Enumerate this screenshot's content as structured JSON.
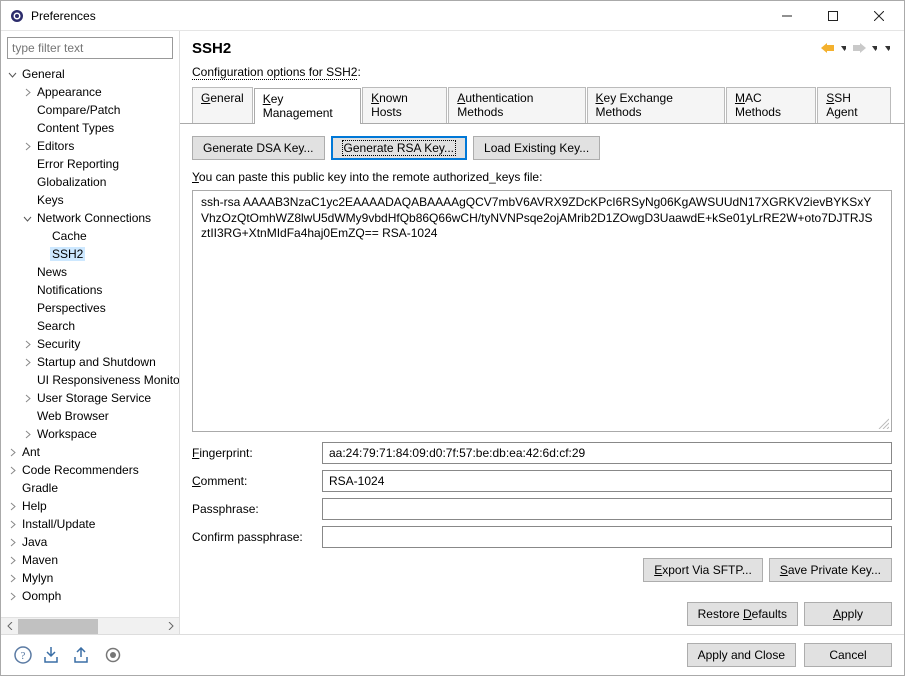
{
  "window": {
    "title": "Preferences"
  },
  "filter": {
    "placeholder": "type filter text"
  },
  "tree": {
    "items": [
      {
        "label": "General",
        "depth": 0,
        "expand": "open"
      },
      {
        "label": "Appearance",
        "depth": 1,
        "expand": "closed"
      },
      {
        "label": "Compare/Patch",
        "depth": 1,
        "expand": "none"
      },
      {
        "label": "Content Types",
        "depth": 1,
        "expand": "none"
      },
      {
        "label": "Editors",
        "depth": 1,
        "expand": "closed"
      },
      {
        "label": "Error Reporting",
        "depth": 1,
        "expand": "none"
      },
      {
        "label": "Globalization",
        "depth": 1,
        "expand": "none"
      },
      {
        "label": "Keys",
        "depth": 1,
        "expand": "none"
      },
      {
        "label": "Network Connections",
        "depth": 1,
        "expand": "open"
      },
      {
        "label": "Cache",
        "depth": 2,
        "expand": "none"
      },
      {
        "label": "SSH2",
        "depth": 2,
        "expand": "none",
        "selected": true
      },
      {
        "label": "News",
        "depth": 1,
        "expand": "none"
      },
      {
        "label": "Notifications",
        "depth": 1,
        "expand": "none"
      },
      {
        "label": "Perspectives",
        "depth": 1,
        "expand": "none"
      },
      {
        "label": "Search",
        "depth": 1,
        "expand": "none"
      },
      {
        "label": "Security",
        "depth": 1,
        "expand": "closed"
      },
      {
        "label": "Startup and Shutdown",
        "depth": 1,
        "expand": "closed"
      },
      {
        "label": "UI Responsiveness Monitoring",
        "depth": 1,
        "expand": "none"
      },
      {
        "label": "User Storage Service",
        "depth": 1,
        "expand": "closed"
      },
      {
        "label": "Web Browser",
        "depth": 1,
        "expand": "none"
      },
      {
        "label": "Workspace",
        "depth": 1,
        "expand": "closed"
      },
      {
        "label": "Ant",
        "depth": 0,
        "expand": "closed"
      },
      {
        "label": "Code Recommenders",
        "depth": 0,
        "expand": "closed"
      },
      {
        "label": "Gradle",
        "depth": 0,
        "expand": "none"
      },
      {
        "label": "Help",
        "depth": 0,
        "expand": "closed"
      },
      {
        "label": "Install/Update",
        "depth": 0,
        "expand": "closed"
      },
      {
        "label": "Java",
        "depth": 0,
        "expand": "closed"
      },
      {
        "label": "Maven",
        "depth": 0,
        "expand": "closed"
      },
      {
        "label": "Mylyn",
        "depth": 0,
        "expand": "closed"
      },
      {
        "label": "Oomph",
        "depth": 0,
        "expand": "closed"
      }
    ]
  },
  "page": {
    "title": "SSH2",
    "description": "Configuration options for SSH2"
  },
  "tabs": {
    "items": [
      {
        "label": "General",
        "active": false
      },
      {
        "label": "Key Management",
        "active": true
      },
      {
        "label": "Known Hosts",
        "active": false
      },
      {
        "label": "Authentication Methods",
        "active": false
      },
      {
        "label": "Key Exchange Methods",
        "active": false
      },
      {
        "label": "MAC Methods",
        "active": false
      },
      {
        "label": "SSH Agent",
        "active": false
      }
    ]
  },
  "keymgmt": {
    "gen_dsa": "Generate DSA Key...",
    "gen_rsa": "Generate RSA Key...",
    "load_key": "Load Existing Key...",
    "hint_pre": "Y",
    "hint_rest": "ou can paste this public key into the remote authorized_keys file:",
    "public_key": "ssh-rsa AAAAB3NzaC1yc2EAAAADAQABAAAAgQCV7mbV6AVRX9ZDcKPcI6RSyNg06KgAWSUUdN17XGRKV2ievBYKSxYVhzOzQtOmhWZ8lwU5dWMy9vbdHfQb86Q66wCH/tyNVNPsqe2ojAMrib2D1ZOwgD3UaawdE+kSe01yLrRE2W+oto7DJTRJSztII3RG+XtnMIdFa4haj0EmZQ== RSA-1024",
    "fingerprint_label": "Fingerprint:",
    "fingerprint_mn": "F",
    "fingerprint_rest": "ingerprint:",
    "fingerprint_value": "aa:24:79:71:84:09:d0:7f:57:be:db:ea:42:6d:cf:29",
    "comment_label": "Comment:",
    "comment_mn": "C",
    "comment_rest": "omment:",
    "comment_value": "RSA-1024",
    "passphrase_label": "Passphrase:",
    "confirm_label": "Confirm passphrase:",
    "export_sftp": "Export Via SFTP...",
    "save_private": "Save Private Key..."
  },
  "actions": {
    "restore_defaults": "Restore Defaults",
    "apply": "Apply",
    "apply_close": "Apply and Close",
    "cancel": "Cancel"
  }
}
